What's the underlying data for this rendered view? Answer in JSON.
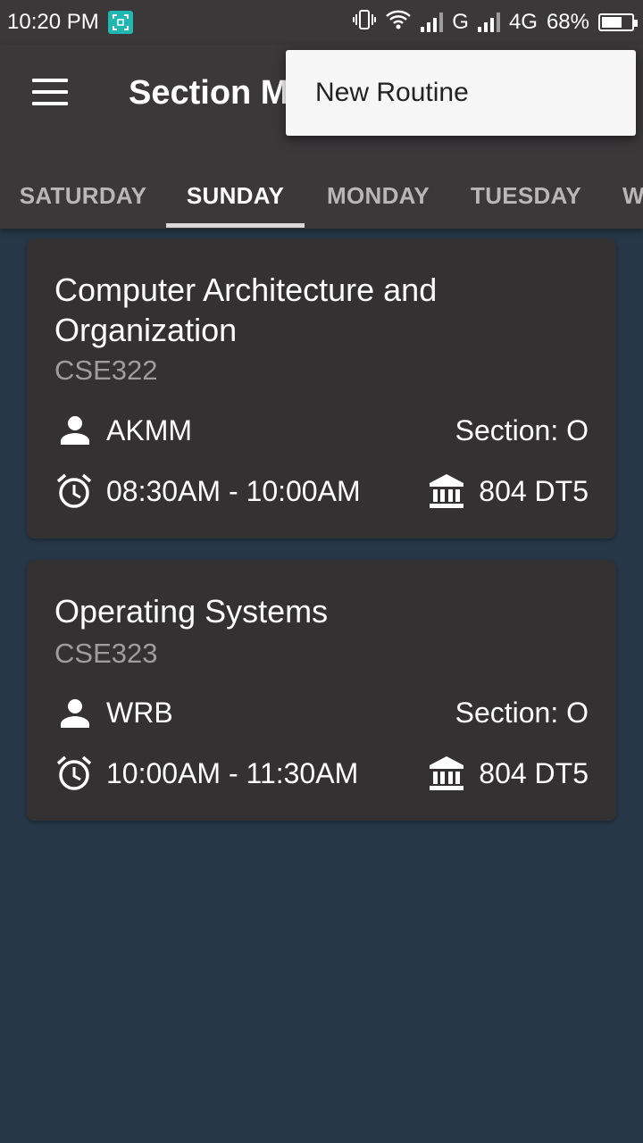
{
  "status_bar": {
    "time": "10:20 PM",
    "network_1": "G",
    "network_2": "4G",
    "battery": "68%",
    "battery_level": 0.68
  },
  "app_bar": {
    "title": "Section M",
    "menu_icon": "hamburger-menu-icon"
  },
  "tabs": [
    "SATURDAY",
    "SUNDAY",
    "MONDAY",
    "TUESDAY",
    "W"
  ],
  "active_tab": "SUNDAY",
  "popup_menu": {
    "items": [
      "New Routine"
    ]
  },
  "courses": [
    {
      "title": "Computer Architecture and Organization",
      "code": "CSE322",
      "teacher": "AKMM",
      "section": "Section: O",
      "time": "08:30AM - 10:00AM",
      "room": "804 DT5"
    },
    {
      "title": "Operating Systems",
      "code": "CSE323",
      "teacher": "WRB",
      "section": "Section: O",
      "time": "10:00AM - 11:30AM",
      "room": "804 DT5"
    }
  ],
  "colors": {
    "background": "#263747",
    "app_bar": "#3a3839",
    "card": "#333132",
    "popup": "#f7f7f7",
    "accent_teal": "#1fb7b0"
  }
}
